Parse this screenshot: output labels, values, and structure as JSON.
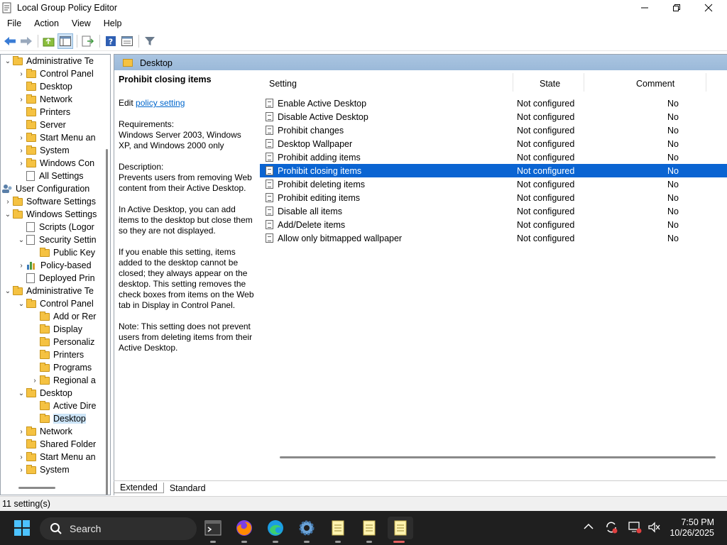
{
  "window": {
    "title": "Local Group Policy Editor"
  },
  "menu": [
    "File",
    "Action",
    "View",
    "Help"
  ],
  "tree": [
    {
      "label": "Administrative Te",
      "indent": 0,
      "chev": "⌄",
      "icon": "folder"
    },
    {
      "label": "Control Panel",
      "indent": 1,
      "chev": "›",
      "icon": "folder"
    },
    {
      "label": "Desktop",
      "indent": 1,
      "chev": "",
      "icon": "folder"
    },
    {
      "label": "Network",
      "indent": 1,
      "chev": "›",
      "icon": "folder"
    },
    {
      "label": "Printers",
      "indent": 1,
      "chev": "",
      "icon": "folder"
    },
    {
      "label": "Server",
      "indent": 1,
      "chev": "",
      "icon": "folder"
    },
    {
      "label": "Start Menu an",
      "indent": 1,
      "chev": "›",
      "icon": "folder"
    },
    {
      "label": "System",
      "indent": 1,
      "chev": "›",
      "icon": "folder"
    },
    {
      "label": "Windows Con",
      "indent": 1,
      "chev": "›",
      "icon": "folder"
    },
    {
      "label": "All Settings",
      "indent": 1,
      "chev": "",
      "icon": "doc"
    },
    {
      "label": "User Configuration",
      "indent": -1,
      "chev": "⌄",
      "icon": "user"
    },
    {
      "label": "Software Settings",
      "indent": 0,
      "chev": "›",
      "icon": "folder"
    },
    {
      "label": "Windows Settings",
      "indent": 0,
      "chev": "⌄",
      "icon": "folder"
    },
    {
      "label": "Scripts (Logor",
      "indent": 1,
      "chev": "",
      "icon": "doc"
    },
    {
      "label": "Security Settin",
      "indent": 1,
      "chev": "⌄",
      "icon": "doc"
    },
    {
      "label": "Public Key",
      "indent": 2,
      "chev": "",
      "icon": "folder"
    },
    {
      "label": "Policy-based",
      "indent": 1,
      "chev": "›",
      "icon": "chart"
    },
    {
      "label": "Deployed Prin",
      "indent": 1,
      "chev": "",
      "icon": "doc"
    },
    {
      "label": "Administrative Te",
      "indent": 0,
      "chev": "⌄",
      "icon": "folder"
    },
    {
      "label": "Control Panel",
      "indent": 1,
      "chev": "⌄",
      "icon": "folder"
    },
    {
      "label": "Add or Rer",
      "indent": 2,
      "chev": "",
      "icon": "folder"
    },
    {
      "label": "Display",
      "indent": 2,
      "chev": "",
      "icon": "folder"
    },
    {
      "label": "Personaliz",
      "indent": 2,
      "chev": "",
      "icon": "folder"
    },
    {
      "label": "Printers",
      "indent": 2,
      "chev": "",
      "icon": "folder"
    },
    {
      "label": "Programs",
      "indent": 2,
      "chev": "",
      "icon": "folder"
    },
    {
      "label": "Regional a",
      "indent": 2,
      "chev": "›",
      "icon": "folder"
    },
    {
      "label": "Desktop",
      "indent": 1,
      "chev": "⌄",
      "icon": "folder"
    },
    {
      "label": "Active Dire",
      "indent": 2,
      "chev": "",
      "icon": "folder"
    },
    {
      "label": "Desktop",
      "indent": 2,
      "chev": "",
      "icon": "folder",
      "selected": true
    },
    {
      "label": "Network",
      "indent": 1,
      "chev": "›",
      "icon": "folder"
    },
    {
      "label": "Shared Folder",
      "indent": 1,
      "chev": "",
      "icon": "folder"
    },
    {
      "label": "Start Menu an",
      "indent": 1,
      "chev": "›",
      "icon": "folder"
    },
    {
      "label": "System",
      "indent": 1,
      "chev": "›",
      "icon": "folder"
    }
  ],
  "header": {
    "title": "Desktop"
  },
  "description": {
    "heading": "Prohibit closing items",
    "edit_prefix": "Edit",
    "edit_link": "policy setting",
    "requirements": "Requirements:\nWindows Server 2003, Windows XP, and Windows 2000 only",
    "p1": "Description:\nPrevents users from removing Web content from their Active Desktop.",
    "p2": "In Active Desktop, you can add items to the desktop but close them so they are not displayed.",
    "p3": "If you enable this setting, items added to the desktop cannot be closed; they always appear on the desktop. This setting removes the check boxes from items on the Web tab in Display in Control Panel.",
    "p4": "Note: This setting does not prevent users from deleting items from their Active Desktop."
  },
  "columns": {
    "setting": "Setting",
    "state": "State",
    "comment": "Comment"
  },
  "rows": [
    {
      "setting": "Enable Active Desktop",
      "state": "Not configured",
      "comment": "No"
    },
    {
      "setting": "Disable Active Desktop",
      "state": "Not configured",
      "comment": "No"
    },
    {
      "setting": "Prohibit changes",
      "state": "Not configured",
      "comment": "No"
    },
    {
      "setting": "Desktop Wallpaper",
      "state": "Not configured",
      "comment": "No"
    },
    {
      "setting": "Prohibit adding items",
      "state": "Not configured",
      "comment": "No"
    },
    {
      "setting": "Prohibit closing items",
      "state": "Not configured",
      "comment": "No",
      "selected": true
    },
    {
      "setting": "Prohibit deleting items",
      "state": "Not configured",
      "comment": "No"
    },
    {
      "setting": "Prohibit editing items",
      "state": "Not configured",
      "comment": "No"
    },
    {
      "setting": "Disable all items",
      "state": "Not configured",
      "comment": "No"
    },
    {
      "setting": "Add/Delete items",
      "state": "Not configured",
      "comment": "No"
    },
    {
      "setting": "Allow only bitmapped wallpaper",
      "state": "Not configured",
      "comment": "No"
    }
  ],
  "tabs": [
    "Extended",
    "Standard"
  ],
  "status": "11 setting(s)",
  "taskbar": {
    "search_placeholder": "Search",
    "time": "7:50 PM",
    "date": "10/26/2025"
  },
  "colors": {
    "selection": "#0a64d2",
    "header_band": "#9bb9d9",
    "taskbar": "#1f1f1f"
  }
}
